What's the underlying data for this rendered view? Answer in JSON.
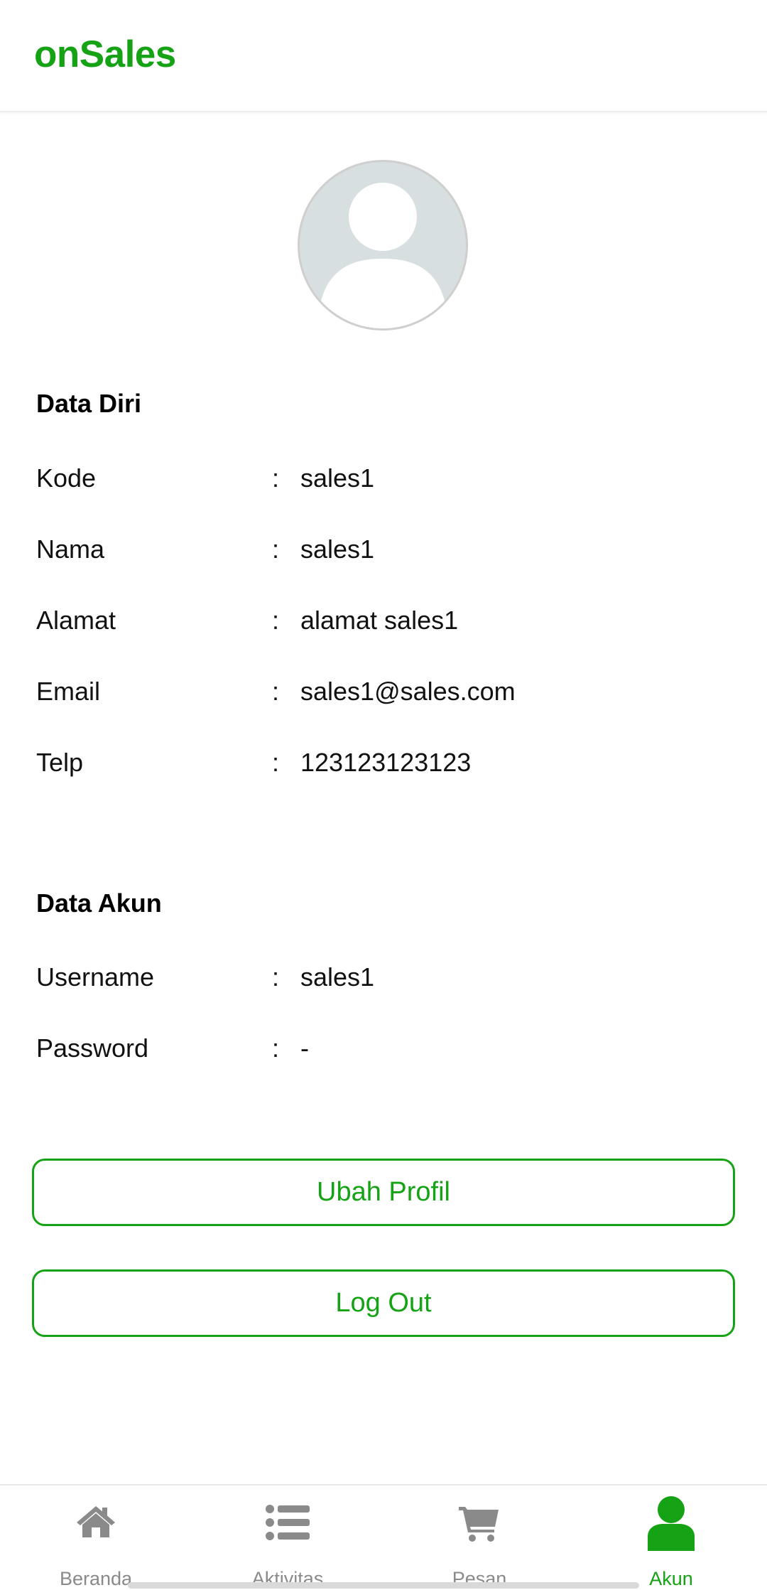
{
  "app": {
    "title": "onSales"
  },
  "profile": {
    "avatar_icon": "default-user-avatar",
    "personal_section": {
      "title": "Data Diri",
      "rows": [
        {
          "label": "Kode",
          "colon": ":",
          "value": "sales1"
        },
        {
          "label": "Nama",
          "colon": ":",
          "value": "sales1"
        },
        {
          "label": "Alamat",
          "colon": ":",
          "value": "alamat sales1"
        },
        {
          "label": "Email",
          "colon": ":",
          "value": "sales1@sales.com"
        },
        {
          "label": "Telp",
          "colon": ":",
          "value": "123123123123"
        }
      ]
    },
    "account_section": {
      "title": "Data Akun",
      "rows": [
        {
          "label": "Username",
          "colon": ":",
          "value": "sales1"
        },
        {
          "label": "Password",
          "colon": ":",
          "value": "-"
        }
      ]
    }
  },
  "actions": {
    "edit_profile_label": "Ubah Profil",
    "logout_label": "Log Out"
  },
  "bottom_nav": {
    "items": [
      {
        "label": "Beranda",
        "icon": "home-icon",
        "active": false
      },
      {
        "label": "Aktivitas",
        "icon": "list-icon",
        "active": false
      },
      {
        "label": "Pesan",
        "icon": "cart-icon",
        "active": false
      },
      {
        "label": "Akun",
        "icon": "user-icon",
        "active": true
      }
    ]
  },
  "colors": {
    "brand": "#15a315",
    "inactive_nav": "#8a8a8a",
    "avatar_bg": "#d7dfe0"
  }
}
